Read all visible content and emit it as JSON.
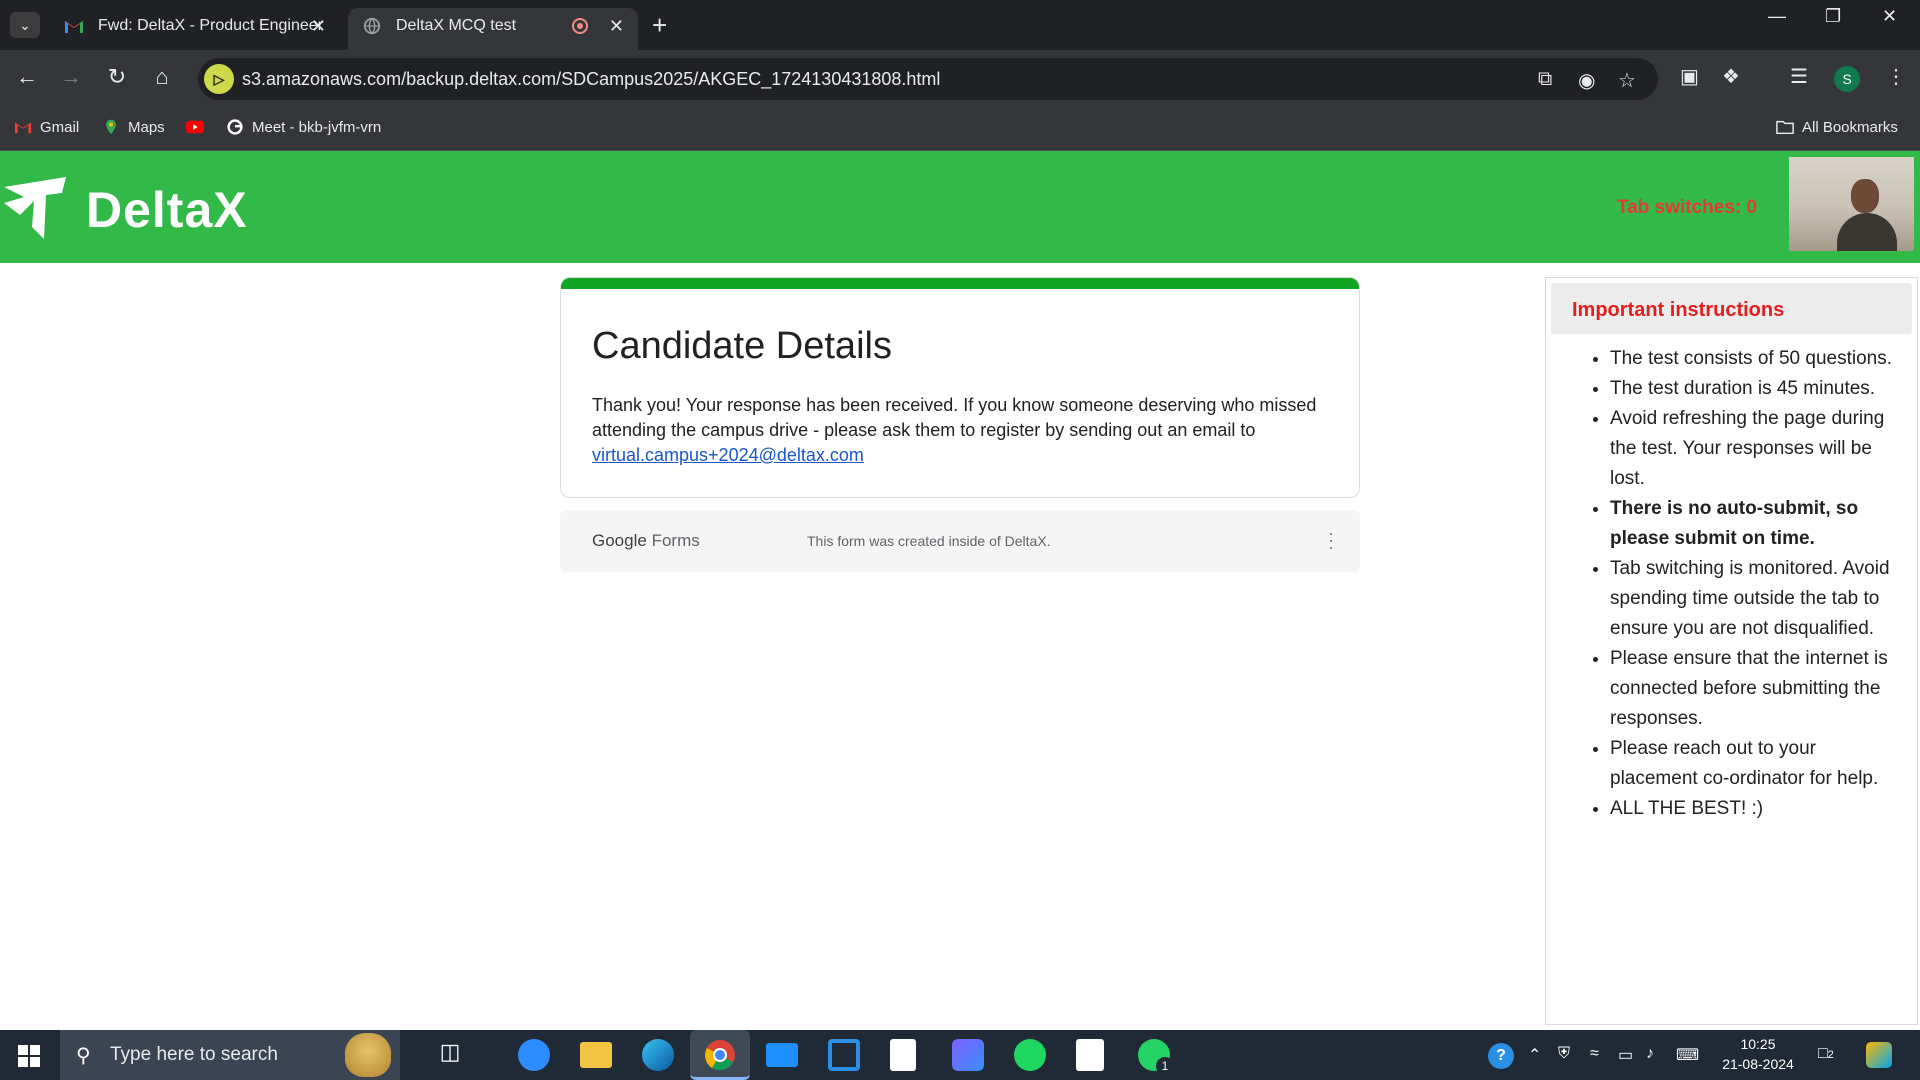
{
  "browser": {
    "tabs": [
      {
        "title": "Fwd: DeltaX - Product Engineer",
        "icon": "gmail-icon"
      },
      {
        "title": "DeltaX MCQ test",
        "icon": "globe-icon",
        "recording": true
      }
    ],
    "new_tab_label": "+",
    "url": "s3.amazonaws.com/backup.deltax.com/SDCampus2025/AKGEC_1724130431808.html",
    "profile_initial": "S",
    "bookmarks": [
      {
        "label": "Gmail",
        "icon": "gmail-icon"
      },
      {
        "label": "Maps",
        "icon": "maps-icon"
      },
      {
        "label": "",
        "icon": "youtube-icon"
      },
      {
        "label": "Meet - bkb-jvfm-vrn",
        "icon": "google-icon"
      }
    ],
    "all_bookmarks_label": "All Bookmarks"
  },
  "header": {
    "logo_text": "DeltaX",
    "tab_switches": "Tab switches: 0",
    "bg_color": "#33b948",
    "warning_color": "#e53935"
  },
  "form": {
    "title": "Candidate Details",
    "message": "Thank you! Your response has been received. If you know someone deserving who missed attending the campus drive - please ask them to register by sending out an email to",
    "email_link": "virtual.campus+2024@deltax.com",
    "accent_color": "#11a521",
    "footer_brand_google": "Google",
    "footer_brand_forms": "Forms",
    "footer_note": "This form was created inside of DeltaX."
  },
  "instructions": {
    "title": "Important instructions",
    "items": [
      "The test consists of 50 questions.",
      "The test duration is 45 minutes.",
      "Avoid refreshing the page during the test. Your responses will be lost.",
      "There is no auto-submit, so please submit on time.",
      "Tab switching is monitored. Avoid spending time outside the tab to ensure you are not disqualified.",
      "Please ensure that the internet is connected before submitting the responses.",
      "Please reach out to your placement co-ordinator for help.",
      "ALL THE BEST! :)"
    ],
    "title_color": "#e01f1f"
  },
  "taskbar": {
    "search_placeholder": "Type here to search",
    "time": "10:25",
    "date": "21-08-2024",
    "notification_count": "2",
    "whatsapp_badge": "1"
  }
}
